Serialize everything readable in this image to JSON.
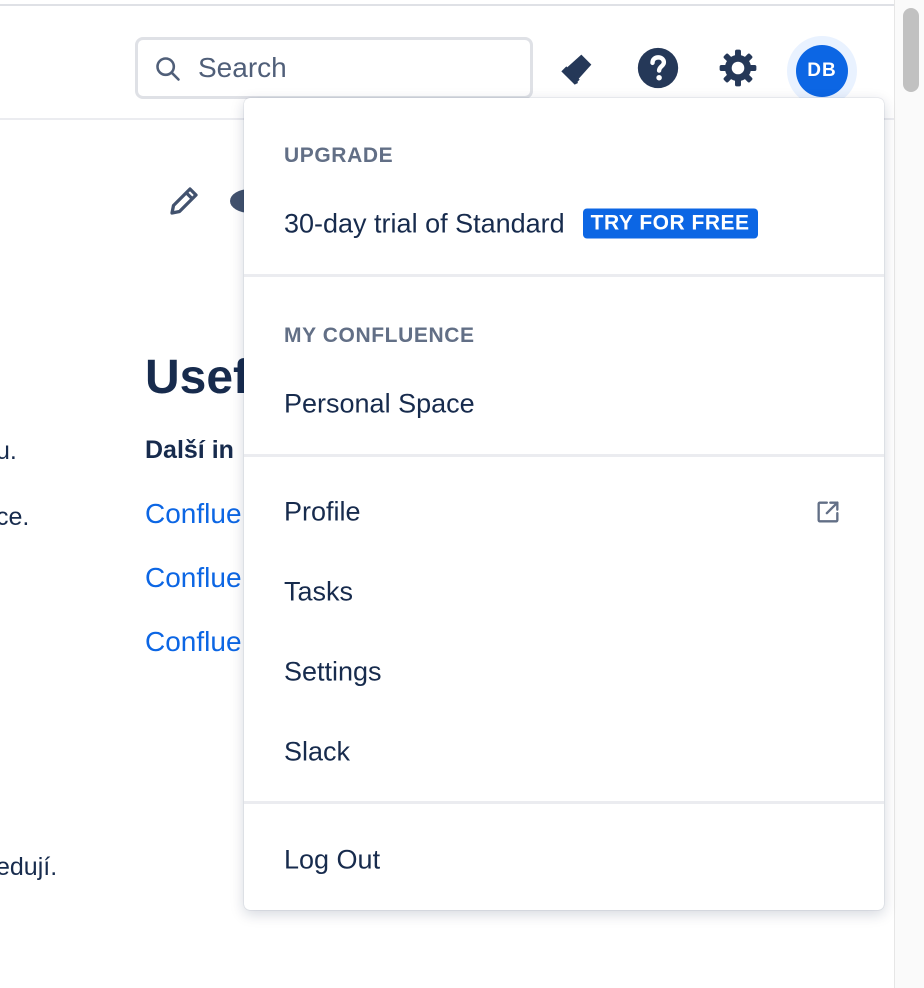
{
  "header": {
    "search_placeholder": "Search",
    "avatar_initials": "DB",
    "icons": [
      "megaphone-icon",
      "help-icon",
      "settings-icon"
    ]
  },
  "background": {
    "title": "Usef",
    "bold_text": "Další in",
    "links": [
      "Conflue",
      "Conflue",
      "Conflue"
    ],
    "left_texts": [
      "u.",
      "ce.",
      "edují."
    ]
  },
  "menu": {
    "upgrade": {
      "header": "UPGRADE",
      "trial_label": "30-day trial of Standard",
      "badge": "TRY FOR FREE"
    },
    "my_confluence": {
      "header": "MY CONFLUENCE",
      "personal_space": "Personal Space"
    },
    "items": {
      "profile": "Profile",
      "tasks": "Tasks",
      "settings": "Settings",
      "slack": "Slack"
    },
    "logout": "Log Out"
  },
  "colors": {
    "accent": "#0c66e4",
    "text": "#172b4d",
    "subtle": "#626f86"
  }
}
